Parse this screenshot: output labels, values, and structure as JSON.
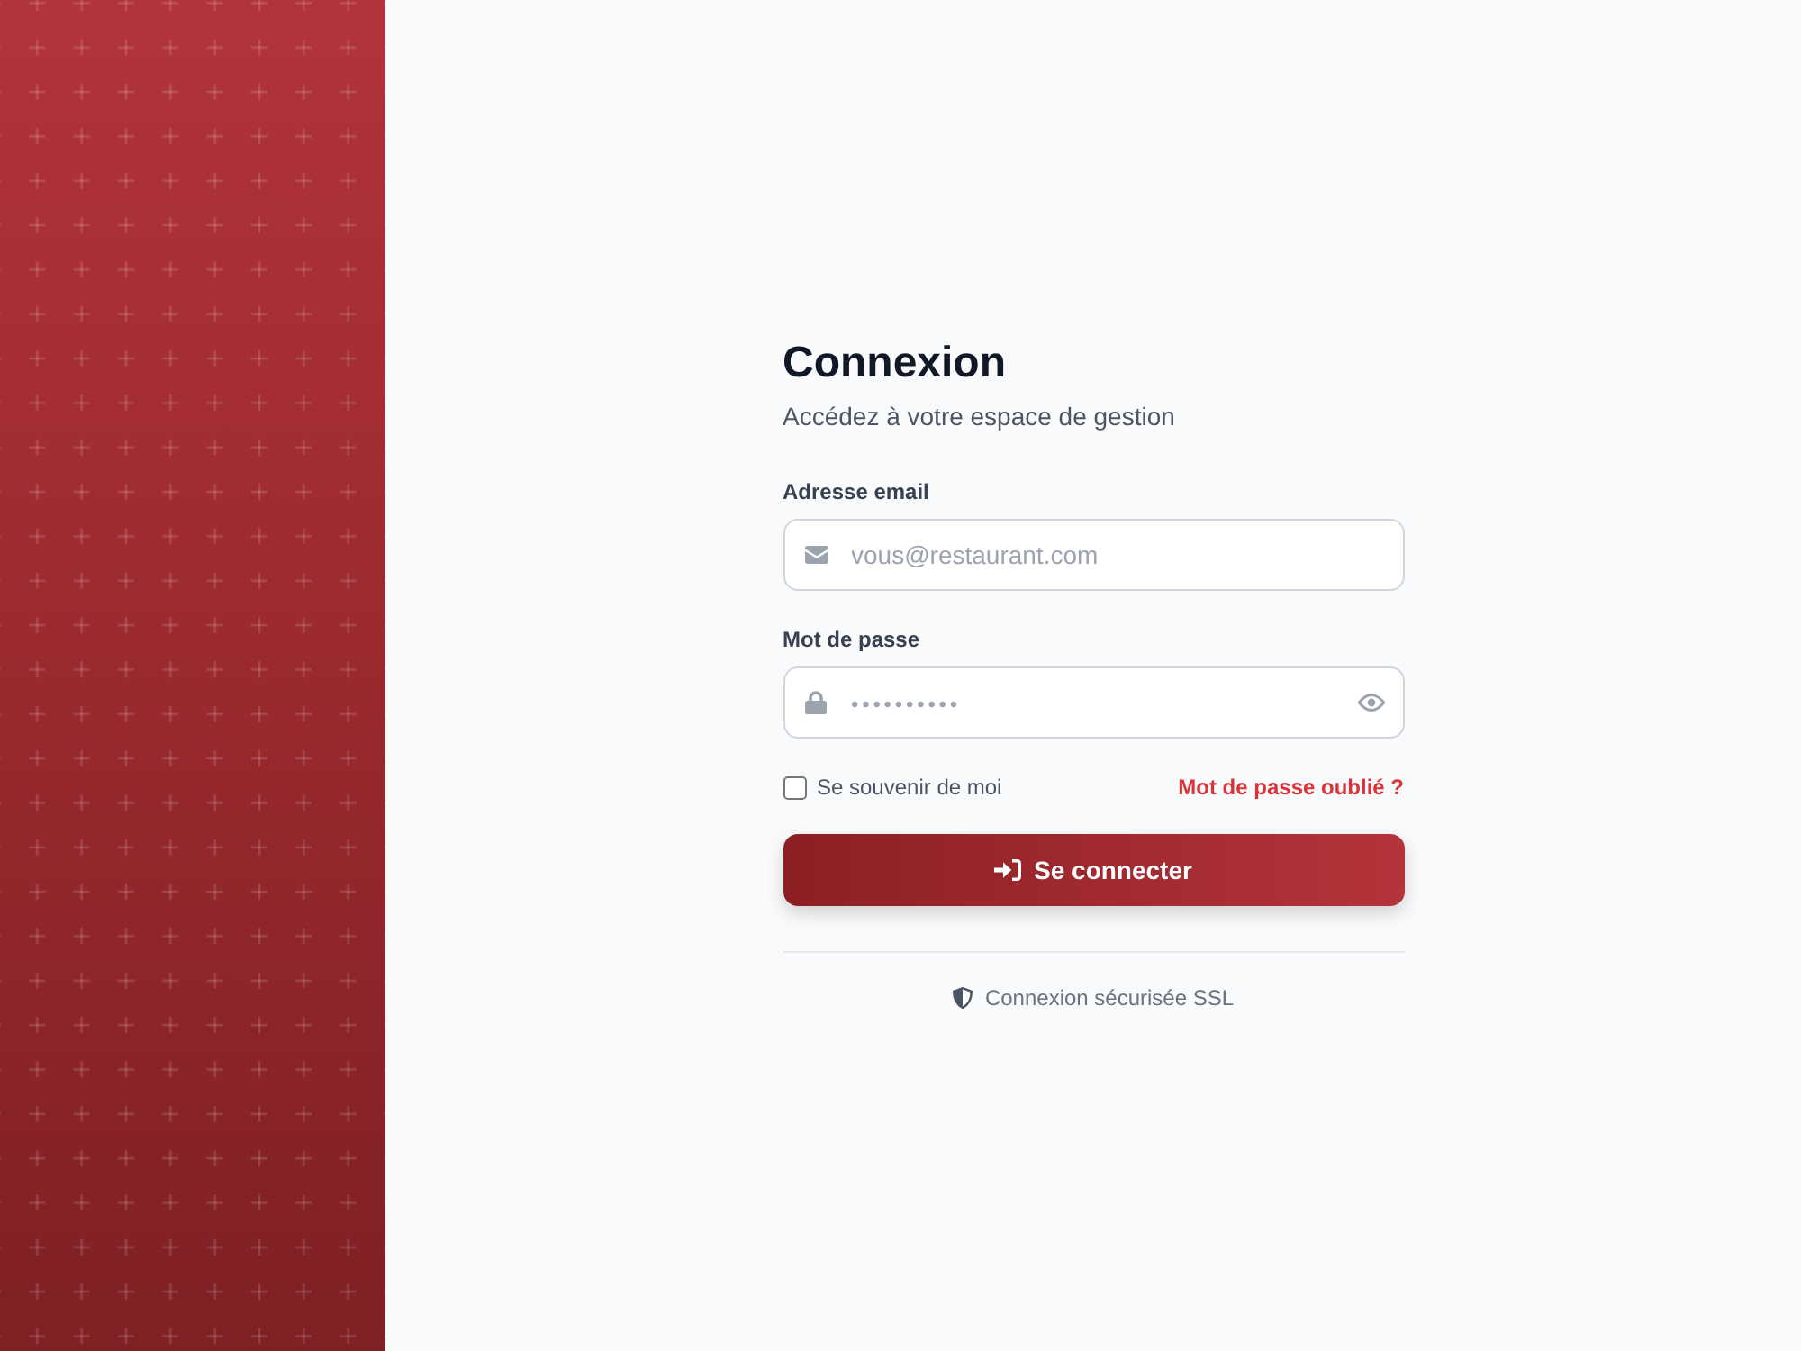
{
  "login": {
    "title": "Connexion",
    "subtitle": "Accédez à votre espace de gestion",
    "fields": [
      {
        "kind": "email",
        "label": "Adresse email",
        "placeholder": "vous@restaurant.com"
      },
      {
        "kind": "password",
        "label": "Mot de passe",
        "placeholder": "••••••••••"
      }
    ],
    "remember": {
      "label": "Se souvenir de moi",
      "checked": false
    },
    "forgot_link": "Mot de passe oublié ?",
    "submit": "Se connecter",
    "footer": "Connexion sécurisée SSL"
  }
}
